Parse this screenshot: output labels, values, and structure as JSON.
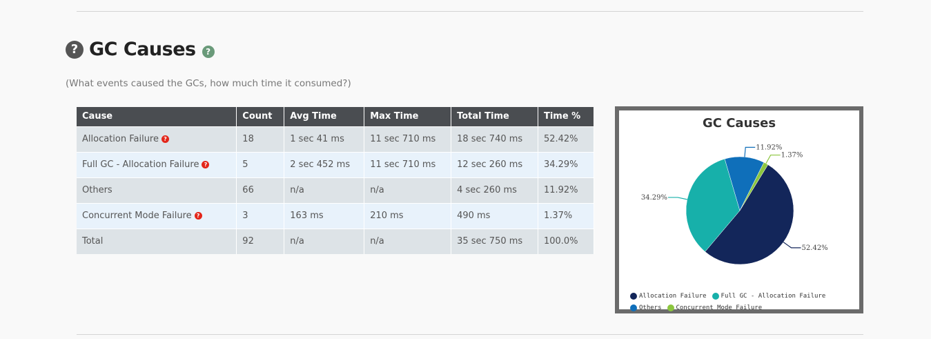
{
  "section": {
    "title": "GC Causes",
    "subtitle": "(What events caused the GCs, how much time it consumed?)",
    "help_dark_glyph": "?",
    "help_green_glyph": "?"
  },
  "table": {
    "headers": [
      "Cause",
      "Count",
      "Avg Time",
      "Max Time",
      "Total Time",
      "Time %"
    ],
    "rows": [
      {
        "cause": "Allocation Failure",
        "help": true,
        "count": "18",
        "avg": "1 sec 41 ms",
        "max": "11 sec 710 ms",
        "total": "18 sec 740 ms",
        "pct": "52.42%"
      },
      {
        "cause": "Full GC - Allocation Failure",
        "help": true,
        "count": "5",
        "avg": "2 sec 452 ms",
        "max": "11 sec 710 ms",
        "total": "12 sec 260 ms",
        "pct": "34.29%"
      },
      {
        "cause": "Others",
        "help": false,
        "count": "66",
        "avg": "n/a",
        "max": "n/a",
        "total": "4 sec 260 ms",
        "pct": "11.92%"
      },
      {
        "cause": "Concurrent Mode Failure",
        "help": true,
        "count": "3",
        "avg": "163 ms",
        "max": "210 ms",
        "total": "490 ms",
        "pct": "1.37%"
      },
      {
        "cause": "Total",
        "help": false,
        "count": "92",
        "avg": "n/a",
        "max": "n/a",
        "total": "35 sec 750 ms",
        "pct": "100.0%"
      }
    ]
  },
  "chart_data": {
    "type": "pie",
    "title": "GC Causes",
    "categories": [
      "Allocation Failure",
      "Full GC - Allocation Failure",
      "Others",
      "Concurrent Mode Failure"
    ],
    "values": [
      52.42,
      34.29,
      11.92,
      1.37
    ],
    "labels": [
      "52.42%",
      "34.29%",
      "11.92%",
      "1.37%"
    ],
    "colors": [
      "#13265a",
      "#17b0aa",
      "#0f6fba",
      "#8cc63f"
    ],
    "legend": "bottom"
  }
}
